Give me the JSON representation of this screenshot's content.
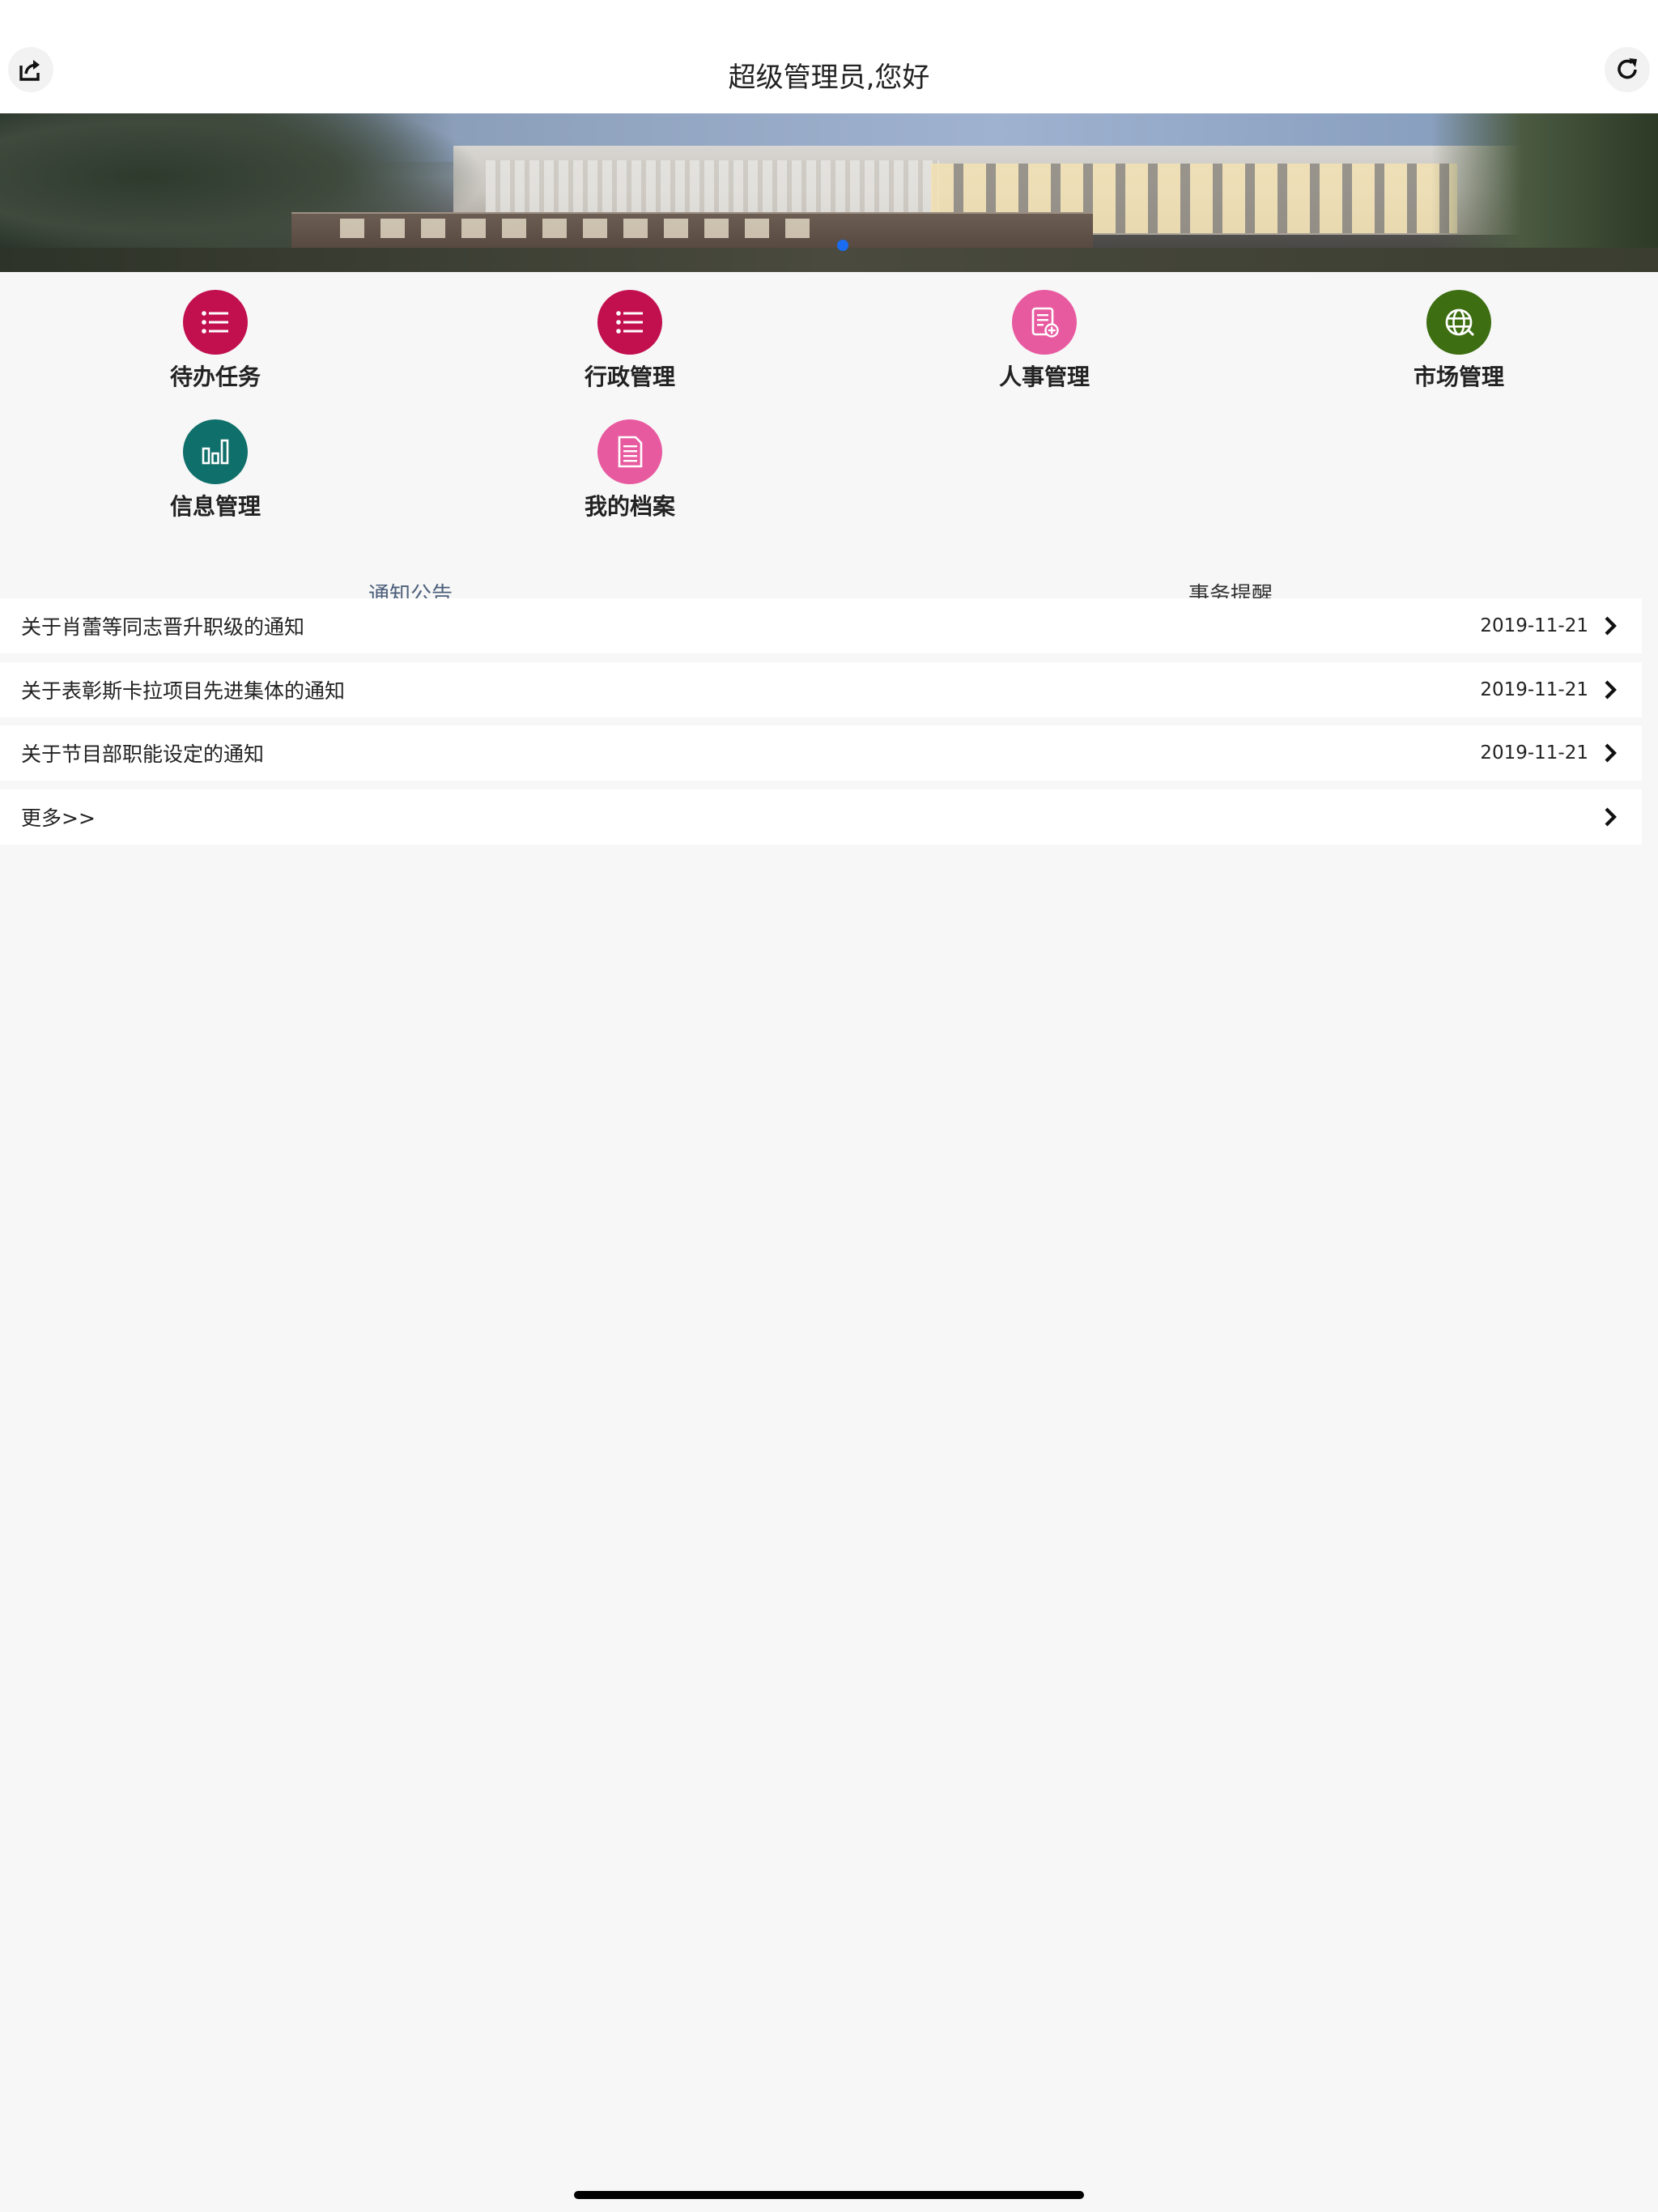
{
  "header": {
    "title": "超级管理员,您好",
    "left_icon": "share-export-icon",
    "right_icon": "refresh-icon"
  },
  "banner": {
    "description_icon": "building-photo",
    "active_dot_color": "#1a6cf0"
  },
  "menu": [
    {
      "label": "待办任务",
      "icon": "list-icon",
      "color": "#c2104f"
    },
    {
      "label": "行政管理",
      "icon": "list-icon",
      "color": "#c2104f"
    },
    {
      "label": "人事管理",
      "icon": "document-add-icon",
      "color": "#e85aa0"
    },
    {
      "label": "市场管理",
      "icon": "globe-icon",
      "color": "#3d6e12"
    },
    {
      "label": "信息管理",
      "icon": "bar-chart-icon",
      "color": "#0f6f6a"
    },
    {
      "label": "我的档案",
      "icon": "document-icon",
      "color": "#e85aa0"
    }
  ],
  "tabs": {
    "notice": "通知公告",
    "affairs": "事务提醒"
  },
  "notices": [
    {
      "title": "关于肖蕾等同志晋升职级的通知",
      "date": "2019-11-21"
    },
    {
      "title": "关于表彰斯卡拉项目先进集体的通知",
      "date": "2019-11-21"
    },
    {
      "title": "关于节目部职能设定的通知",
      "date": "2019-11-21"
    }
  ],
  "more_label": "更多>>"
}
